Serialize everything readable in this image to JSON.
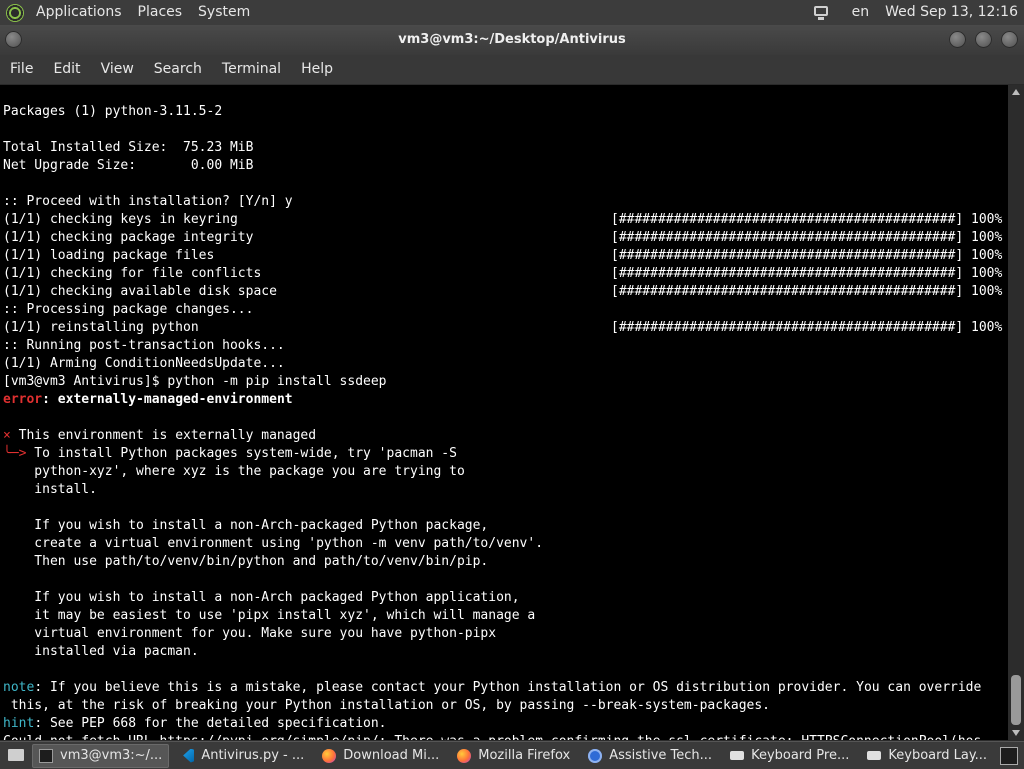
{
  "top_panel": {
    "menus": [
      "Applications",
      "Places",
      "System"
    ],
    "lang": "en",
    "datetime": "Wed Sep 13, 12:16"
  },
  "window": {
    "title": "vm3@vm3:~/Desktop/Antivirus"
  },
  "menubar": [
    "File",
    "Edit",
    "View",
    "Search",
    "Terminal",
    "Help"
  ],
  "terminal": {
    "lines": [
      {
        "text": "Packages (1) python-3.11.5-2"
      },
      {
        "text": ""
      },
      {
        "text": "Total Installed Size:  75.23 MiB"
      },
      {
        "text": "Net Upgrade Size:       0.00 MiB"
      },
      {
        "text": ""
      },
      {
        "text": ":: Proceed with installation? [Y/n] y"
      },
      {
        "text": "(1/1) checking keys in keyring",
        "progress": "[###########################################] 100%"
      },
      {
        "text": "(1/1) checking package integrity",
        "progress": "[###########################################] 100%"
      },
      {
        "text": "(1/1) loading package files",
        "progress": "[###########################################] 100%"
      },
      {
        "text": "(1/1) checking for file conflicts",
        "progress": "[###########################################] 100%"
      },
      {
        "text": "(1/1) checking available disk space",
        "progress": "[###########################################] 100%"
      },
      {
        "text": ":: Processing package changes..."
      },
      {
        "text": "(1/1) reinstalling python",
        "progress": "[###########################################] 100%"
      },
      {
        "text": ":: Running post-transaction hooks..."
      },
      {
        "text": "(1/1) Arming ConditionNeedsUpdate..."
      },
      {
        "text": "[vm3@vm3 Antivirus]$ python -m pip install ssdeep"
      },
      {
        "prefix": "error",
        "prefix_style": "red bold",
        "text": ": externally-managed-environment",
        "style": "bold"
      },
      {
        "text": ""
      },
      {
        "prefix": "×",
        "prefix_style": "red",
        "text": " This environment is externally managed"
      },
      {
        "prefix": "╰─>",
        "prefix_style": "red",
        "text": " To install Python packages system-wide, try 'pacman -S"
      },
      {
        "text": "    python-xyz', where xyz is the package you are trying to"
      },
      {
        "text": "    install."
      },
      {
        "text": ""
      },
      {
        "text": "    If you wish to install a non-Arch-packaged Python package,"
      },
      {
        "text": "    create a virtual environment using 'python -m venv path/to/venv'."
      },
      {
        "text": "    Then use path/to/venv/bin/python and path/to/venv/bin/pip."
      },
      {
        "text": ""
      },
      {
        "text": "    If you wish to install a non-Arch packaged Python application,"
      },
      {
        "text": "    it may be easiest to use 'pipx install xyz', which will manage a"
      },
      {
        "text": "    virtual environment for you. Make sure you have python-pipx"
      },
      {
        "text": "    installed via pacman."
      },
      {
        "text": ""
      },
      {
        "prefix": "note",
        "prefix_style": "cyan",
        "text": ": If you believe this is a mistake, please contact your Python installation or OS distribution provider. You can override"
      },
      {
        "text": " this, at the risk of breaking your Python installation or OS, by passing --break-system-packages."
      },
      {
        "prefix": "hint",
        "prefix_style": "cyan",
        "text": ": See PEP 668 for the detailed specification."
      },
      {
        "text": "Could not fetch URL https://pypi.org/simple/pip/: There was a problem confirming the ssl certificate: HTTPSConnectionPool(hos"
      }
    ]
  },
  "taskbar": {
    "tasks": [
      {
        "label": "vm3@vm3:~/...",
        "icon": "terminal-icon",
        "active": true
      },
      {
        "label": "Antivirus.py - ...",
        "icon": "vscode-icon",
        "active": false
      },
      {
        "label": "Download Mi...",
        "icon": "firefox-icon",
        "active": false
      },
      {
        "label": "Mozilla Firefox",
        "icon": "firefox-icon",
        "active": false
      },
      {
        "label": "Assistive Tech...",
        "icon": "accessibility-icon",
        "active": false
      },
      {
        "label": "Keyboard Pre...",
        "icon": "keyboard-icon",
        "active": false
      },
      {
        "label": "Keyboard Lay...",
        "icon": "keyboard-icon",
        "active": false
      }
    ]
  }
}
